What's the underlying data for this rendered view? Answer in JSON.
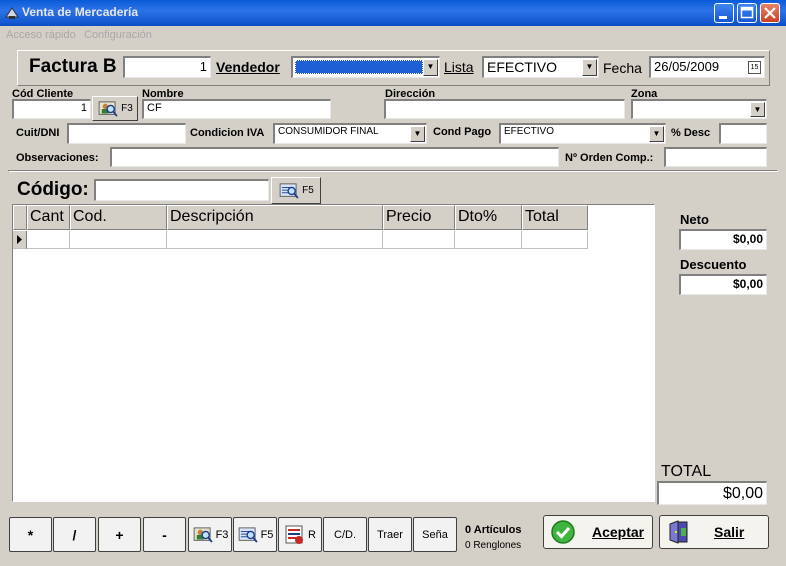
{
  "window": {
    "title": "Venta de Mercadería"
  },
  "menu": {
    "items": [
      "Acceso rápido",
      "Configuración"
    ]
  },
  "header": {
    "invoice_type": "Factura B",
    "invoice_number": "1",
    "vendedor_label": "Vendedor",
    "vendedor_value": "",
    "lista_label": "Lista",
    "lista_value": "EFECTIVO",
    "fecha_label": "Fecha",
    "fecha_value": "26/05/2009"
  },
  "client": {
    "cod_cliente_label": "Cód Cliente",
    "cod_cliente_value": "1",
    "f3_label": "F3",
    "nombre_label": "Nombre",
    "nombre_value": "CF",
    "direccion_label": "Dirección",
    "direccion_value": "",
    "zona_label": "Zona",
    "zona_value": "",
    "cuit_label": "Cuit/DNI",
    "cuit_value": "",
    "condicion_iva_label": "Condicion IVA",
    "condicion_iva_value": "CONSUMIDOR FINAL",
    "cond_pago_label": "Cond Pago",
    "cond_pago_value": "EFECTIVO",
    "desc_label": "% Desc",
    "desc_value": "",
    "observaciones_label": "Observaciones:",
    "observaciones_value": "",
    "orden_label": "Nº Orden Comp.:",
    "orden_value": ""
  },
  "codigo": {
    "label": "Código:",
    "value": "",
    "f5_label": "F5"
  },
  "grid": {
    "columns": [
      "Cant",
      "Cod.",
      "Descripción",
      "Precio",
      "Dto%",
      "Total"
    ]
  },
  "totals": {
    "neto_label": "Neto",
    "neto_value": "$0,00",
    "descuento_label": "Descuento",
    "descuento_value": "$0,00",
    "total_label": "TOTAL",
    "total_value": "$0,00"
  },
  "toolbar": {
    "mult": "*",
    "div": "/",
    "plus": "+",
    "minus": "-",
    "f3": "F3",
    "f5": "F5",
    "r": "R",
    "cd": "C/D.",
    "traer": "Traer",
    "sena": "Seña",
    "articulos": "0 Artículos",
    "renglones": "0 Renglones",
    "aceptar": "Aceptar",
    "salir": "Salir"
  },
  "colors": {
    "titlebar": "#0b4fc6",
    "selection": "#1f5fd6"
  }
}
